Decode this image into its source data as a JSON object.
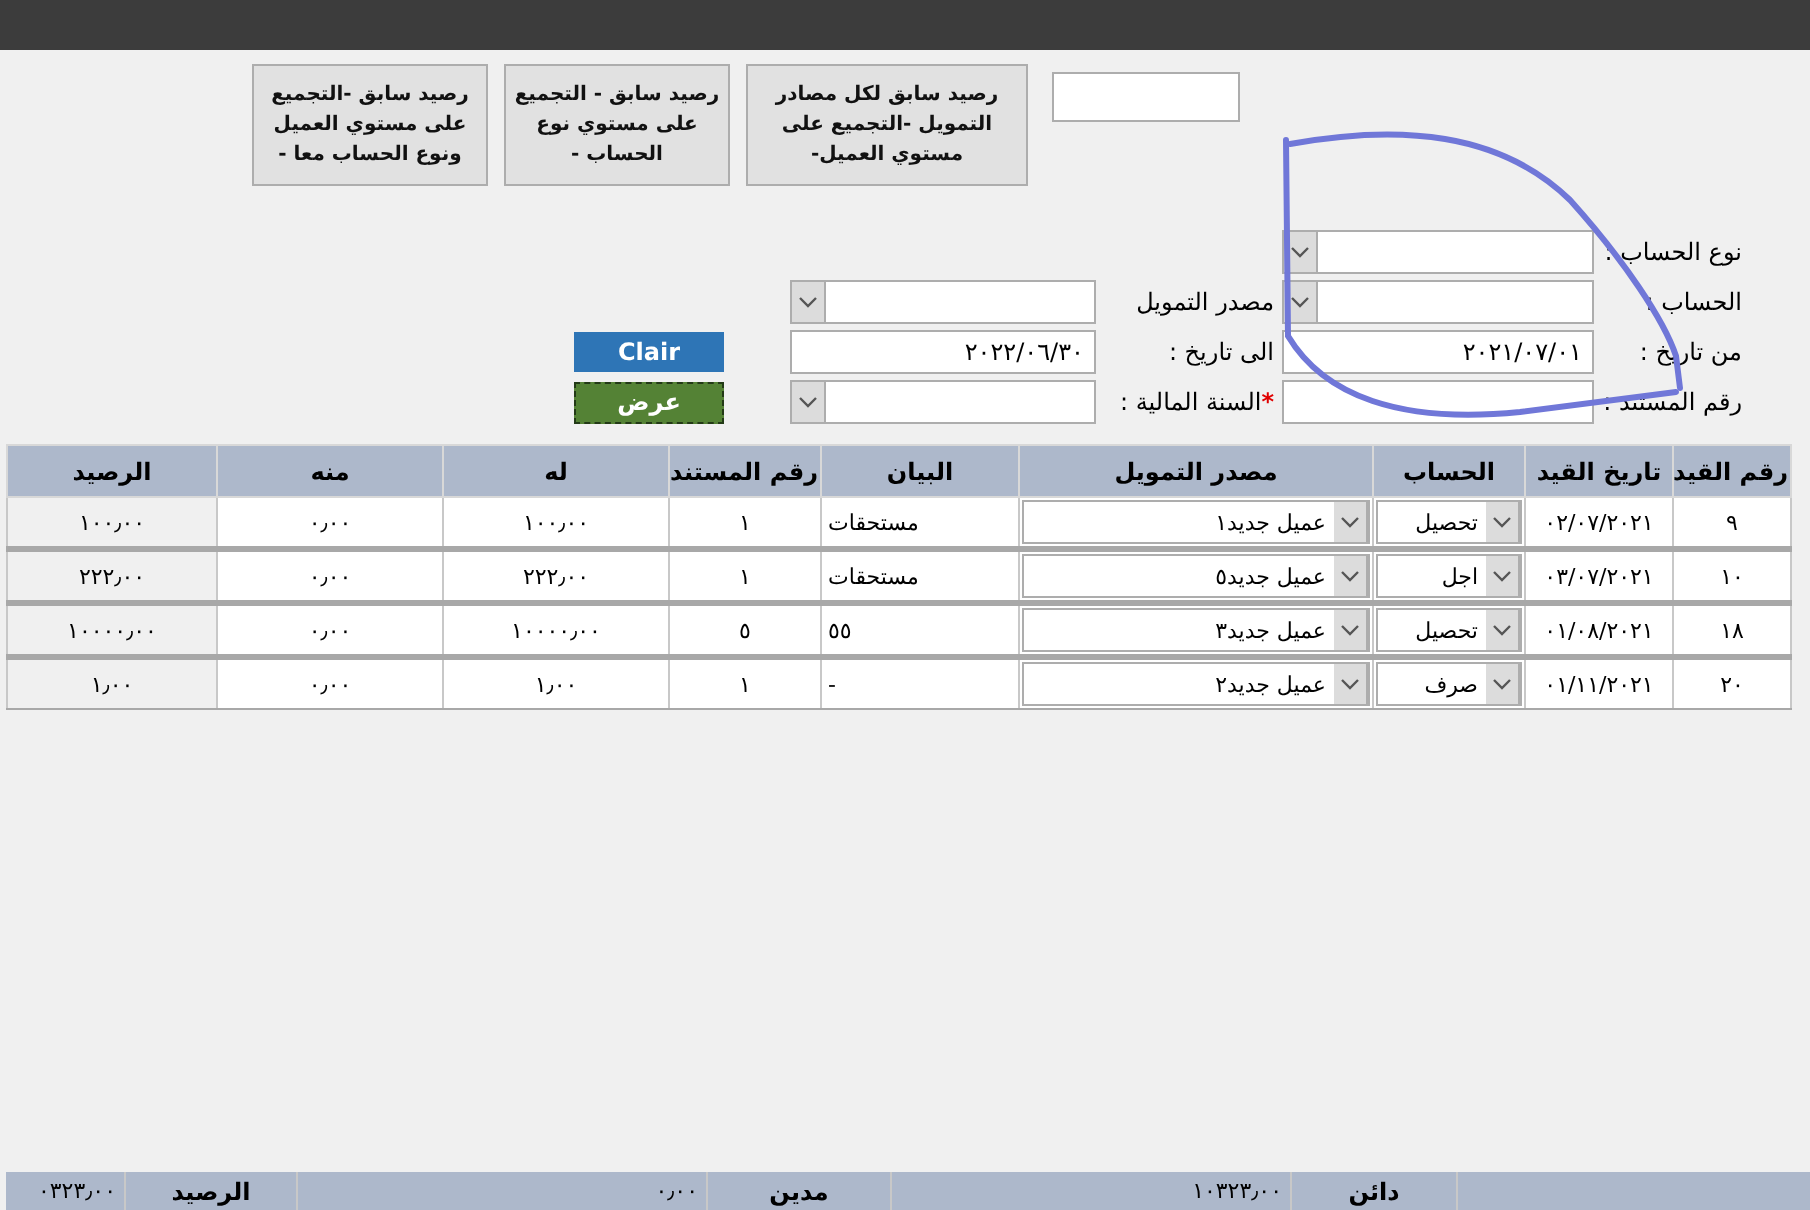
{
  "report_buttons": [
    {
      "label": "رصيد سابق لكل مصادر التمويل -التجميع على مستوي العميل-"
    },
    {
      "label": "رصيد سابق - التجميع على مستوي نوع الحساب -"
    },
    {
      "label": "رصيد سابق -التجميع على مستوي العميل ونوع الحساب معا -"
    }
  ],
  "filters": [
    {
      "kind": "combo",
      "label": "نوع الحساب :"
    },
    {
      "kind": "combo",
      "label": "الحساب :"
    },
    {
      "kind": "combo",
      "label": "مصدر التمويل"
    },
    {
      "kind": "text",
      "label": "من تاريخ :",
      "value": "٢٠٢١/٠٧/٠١"
    },
    {
      "kind": "text",
      "label": "الى  تاريخ :",
      "value": "٢٠٢٢/٠٦/٣٠"
    },
    {
      "kind": "text",
      "label": "رقم المستند :"
    },
    {
      "kind": "combo",
      "label": "السنة المالية :",
      "required_mark": "*"
    }
  ],
  "buttons": [
    {
      "kind": "clear",
      "label": "Clair"
    },
    {
      "kind": "show",
      "label": "عرض"
    }
  ],
  "table": {
    "columns": [
      {
        "label": "رقم القيد",
        "kind": "number"
      },
      {
        "label": "تاريخ القيد",
        "kind": "number"
      },
      {
        "label": "الحساب",
        "kind": "combo"
      },
      {
        "label": "مصدر التمويل",
        "kind": "combo"
      },
      {
        "label": "البيان",
        "kind": "text"
      },
      {
        "label": "رقم المستند",
        "kind": "number"
      },
      {
        "label": "له",
        "kind": "number"
      },
      {
        "label": "منه",
        "kind": "number"
      },
      {
        "label": "الرصيد",
        "kind": "number"
      }
    ],
    "rows": [
      [
        "٩",
        "٠٢/٠٧/٢٠٢١",
        "تحصيل",
        "عميل جديد١",
        "مستحقات",
        "١",
        "١٠٠٫٠٠",
        "٠٫٠٠",
        "١٠٠٫٠٠"
      ],
      [
        "١٠",
        "٠٣/٠٧/٢٠٢١",
        "اجل",
        "عميل جديد٥",
        "مستحقات",
        "١",
        "٢٢٢٫٠٠",
        "٠٫٠٠",
        "٢٢٢٫٠٠"
      ],
      [
        "١٨",
        "٠١/٠٨/٢٠٢١",
        "تحصيل",
        "عميل جديد٣",
        "٥٥",
        "٥",
        "١٠٠٠٠٫٠٠",
        "٠٫٠٠",
        "١٠٠٠٠٫٠٠"
      ],
      [
        "٢٠",
        "٠١/١١/٢٠٢١",
        "صرف",
        "عميل جديد٢",
        "-",
        "١",
        "١٫٠٠",
        "٠٫٠٠",
        "١٫٠٠"
      ]
    ]
  },
  "totals": [
    {
      "label": "دائن",
      "value": "١٠٣٢٣٫٠٠"
    },
    {
      "label": "مدين",
      "value": "٠٫٠٠"
    },
    {
      "label": "الرصيد",
      "value": "٠٣٢٣٫٠٠"
    }
  ]
}
